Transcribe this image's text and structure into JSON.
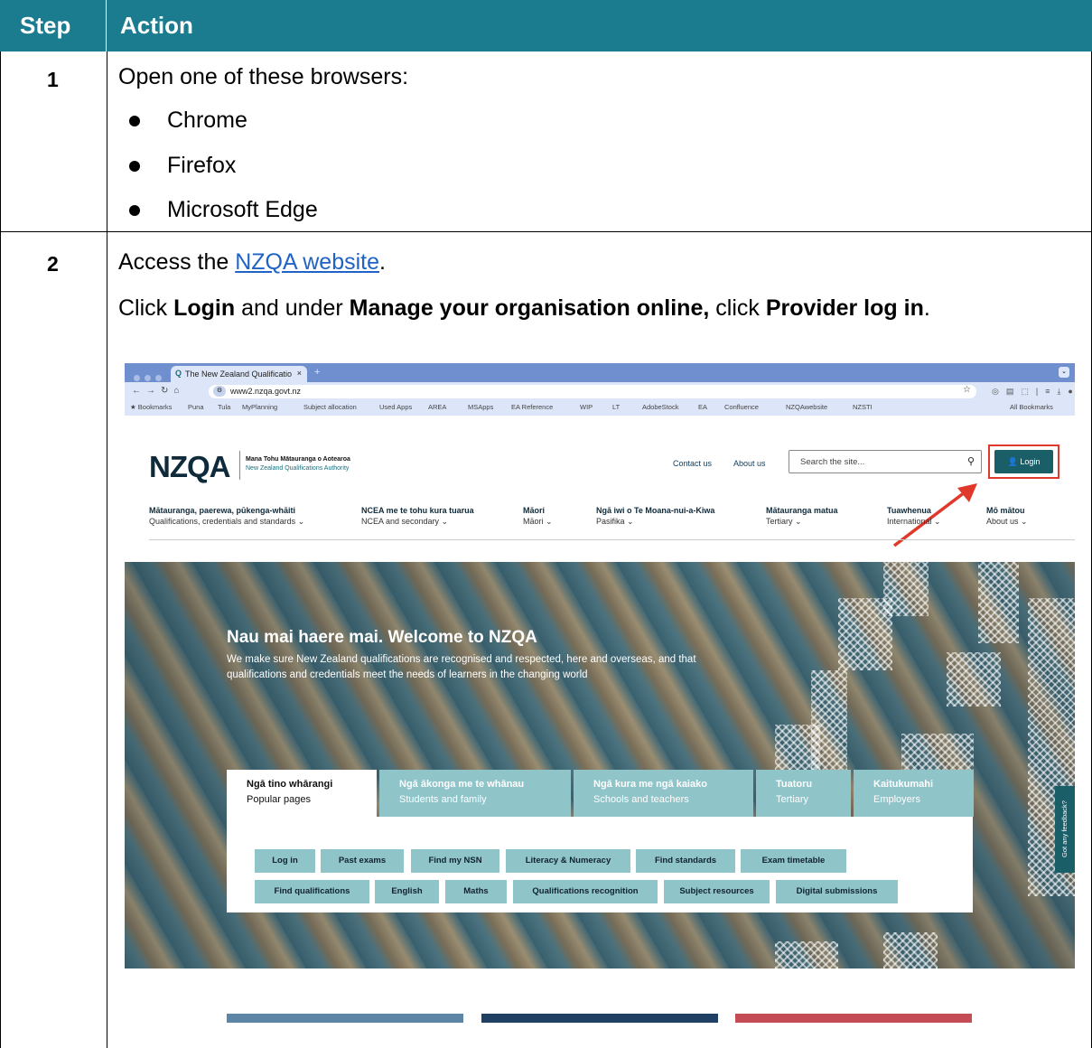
{
  "table": {
    "header": {
      "step": "Step",
      "action": "Action"
    },
    "rows": [
      {
        "step": "1",
        "intro": "Open one of these browsers:",
        "browsers": [
          "Chrome",
          "Firefox",
          "Microsoft Edge"
        ]
      },
      {
        "step": "2",
        "line1_pre": "Access the ",
        "line1_link": "NZQA website",
        "line1_post": ".",
        "line2_a": "Click ",
        "line2_b": "Login",
        "line2_c": " and under ",
        "line2_d": "Manage your organisation online,",
        "line2_e": " click ",
        "line2_f": "Provider log in",
        "line2_g": "."
      }
    ]
  },
  "browser": {
    "tab_title": "The New Zealand Qualificatio",
    "tab_close": "×",
    "new_tab": "+",
    "url": "www2.nzqa.govt.nz",
    "bookmarks": [
      "★ Bookmarks",
      "Puna",
      "Tula",
      "MyPlanning",
      "Subject allocation",
      "Used Apps",
      "AREA",
      "MSApps",
      "EA Reference",
      "WIP",
      "LT",
      "AdobeStock",
      "EA",
      "Confluence",
      "NZQAwebsite",
      "NZSTI",
      "All Bookmarks"
    ]
  },
  "site": {
    "logo": "NZQA",
    "logo_maori": "Mana Tohu Mātauranga o Aotearoa",
    "logo_english": "New Zealand Qualifications Authority",
    "contact": "Contact us",
    "about": "About us",
    "search_placeholder": "Search the site...",
    "login": "Login",
    "nav": [
      {
        "maori": "Mātauranga, paerewa, pūkenga-whāiti",
        "english": "Qualifications, credentials and standards ⌄"
      },
      {
        "maori": "NCEA me te tohu kura tuarua",
        "english": "NCEA and secondary ⌄"
      },
      {
        "maori": "Māori",
        "english": "Māori ⌄"
      },
      {
        "maori": "Ngā iwi o Te Moana-nui-a-Kiwa",
        "english": "Pasifika ⌄"
      },
      {
        "maori": "Mātauranga matua",
        "english": "Tertiary ⌄"
      },
      {
        "maori": "Tuawhenua",
        "english": "International ⌄"
      },
      {
        "maori": "Mō mātou",
        "english": "About us ⌄"
      }
    ],
    "hero_title": "Nau mai haere mai. Welcome to NZQA",
    "hero_desc": "We make sure New Zealand qualifications are recognised and respected, here and overseas, and that qualifications and credentials meet the needs of learners in the changing world",
    "tabs": [
      {
        "maori": "Ngā tino whārangi",
        "english": "Popular pages"
      },
      {
        "maori": "Ngā ākonga me te whānau",
        "english": "Students and family"
      },
      {
        "maori": "Ngā kura me ngā kaiako",
        "english": "Schools and teachers"
      },
      {
        "maori": "Tuatoru",
        "english": "Tertiary"
      },
      {
        "maori": "Kaitukumahi",
        "english": "Employers"
      }
    ],
    "quick_links": [
      "Log in",
      "Past exams",
      "Find my NSN",
      "Literacy & Numeracy",
      "Find standards",
      "Exam timetable",
      "Find qualifications",
      "English",
      "Maths",
      "Qualifications recognition",
      "Subject resources",
      "Digital submissions"
    ],
    "feedback": "Got any feedback?"
  }
}
